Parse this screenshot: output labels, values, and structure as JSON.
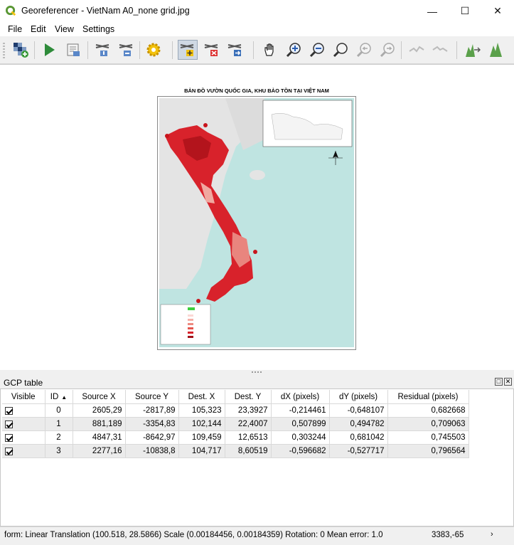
{
  "window": {
    "title": "Georeferencer - VietNam A0_none grid.jpg",
    "minimize_glyph": "—",
    "maximize_glyph": "☐",
    "close_glyph": "✕"
  },
  "menu": [
    "File",
    "Edit",
    "View",
    "Settings"
  ],
  "toolbar": {
    "icons": [
      "open-raster-icon",
      "start-georeferencing-icon",
      "generate-gdal-script-icon",
      "load-gcp-points-icon",
      "save-gcp-points-icon",
      "transformation-settings-icon",
      "add-point-icon",
      "delete-point-icon",
      "move-gcp-point-icon",
      "pan-icon",
      "zoom-in-icon",
      "zoom-out-icon",
      "zoom-to-layer-icon",
      "zoom-last-icon",
      "zoom-next-icon",
      "link-georeferencer-to-qgis-icon",
      "link-qgis-to-georeferencer-icon",
      "full-histogram-stretch-icon",
      "local-histogram-stretch-icon"
    ],
    "active": "add-point-icon"
  },
  "map": {
    "title": "BẢN ĐỒ VƯỜN QUỐC GIA, KHU BẢO TỒN TẠI VIỆT NAM"
  },
  "gcp_panel": {
    "title": "GCP table",
    "float_glyph": "□",
    "close_glyph": "✕",
    "columns": [
      "Visible",
      "ID",
      "Source X",
      "Source Y",
      "Dest. X",
      "Dest. Y",
      "dX (pixels)",
      "dY (pixels)",
      "Residual (pixels)"
    ],
    "sort_glyph": "▲",
    "rows": [
      {
        "visible": true,
        "id": "0",
        "source_x": "2605,29",
        "source_y": "-2817,89",
        "dest_x": "105,323",
        "dest_y": "23,3927",
        "dx": "-0,214461",
        "dy": "-0,648107",
        "residual": "0,682668"
      },
      {
        "visible": true,
        "id": "1",
        "source_x": "881,189",
        "source_y": "-3354,83",
        "dest_x": "102,144",
        "dest_y": "22,4007",
        "dx": "0,507899",
        "dy": "0,494782",
        "residual": "0,709063"
      },
      {
        "visible": true,
        "id": "2",
        "source_x": "4847,31",
        "source_y": "-8642,97",
        "dest_x": "109,459",
        "dest_y": "12,6513",
        "dx": "0,303244",
        "dy": "0,681042",
        "residual": "0,745503"
      },
      {
        "visible": true,
        "id": "3",
        "source_x": "2277,16",
        "source_y": "-10838,8",
        "dest_x": "104,717",
        "dest_y": "8,60519",
        "dx": "-0,596682",
        "dy": "-0,527717",
        "residual": "0,796564"
      }
    ]
  },
  "status": {
    "message": "form: Linear Translation (100.518, 28.5866) Scale (0.00184456, 0.00184359) Rotation: 0 Mean error: 1.0",
    "coordinates": "3383,-65",
    "arrow_glyph": "›"
  },
  "colors": {
    "qgis_green": "#589632",
    "qgis_yellow": "#f3c20d",
    "sea": "#bfe4e1",
    "land_red": "#d8222b"
  }
}
